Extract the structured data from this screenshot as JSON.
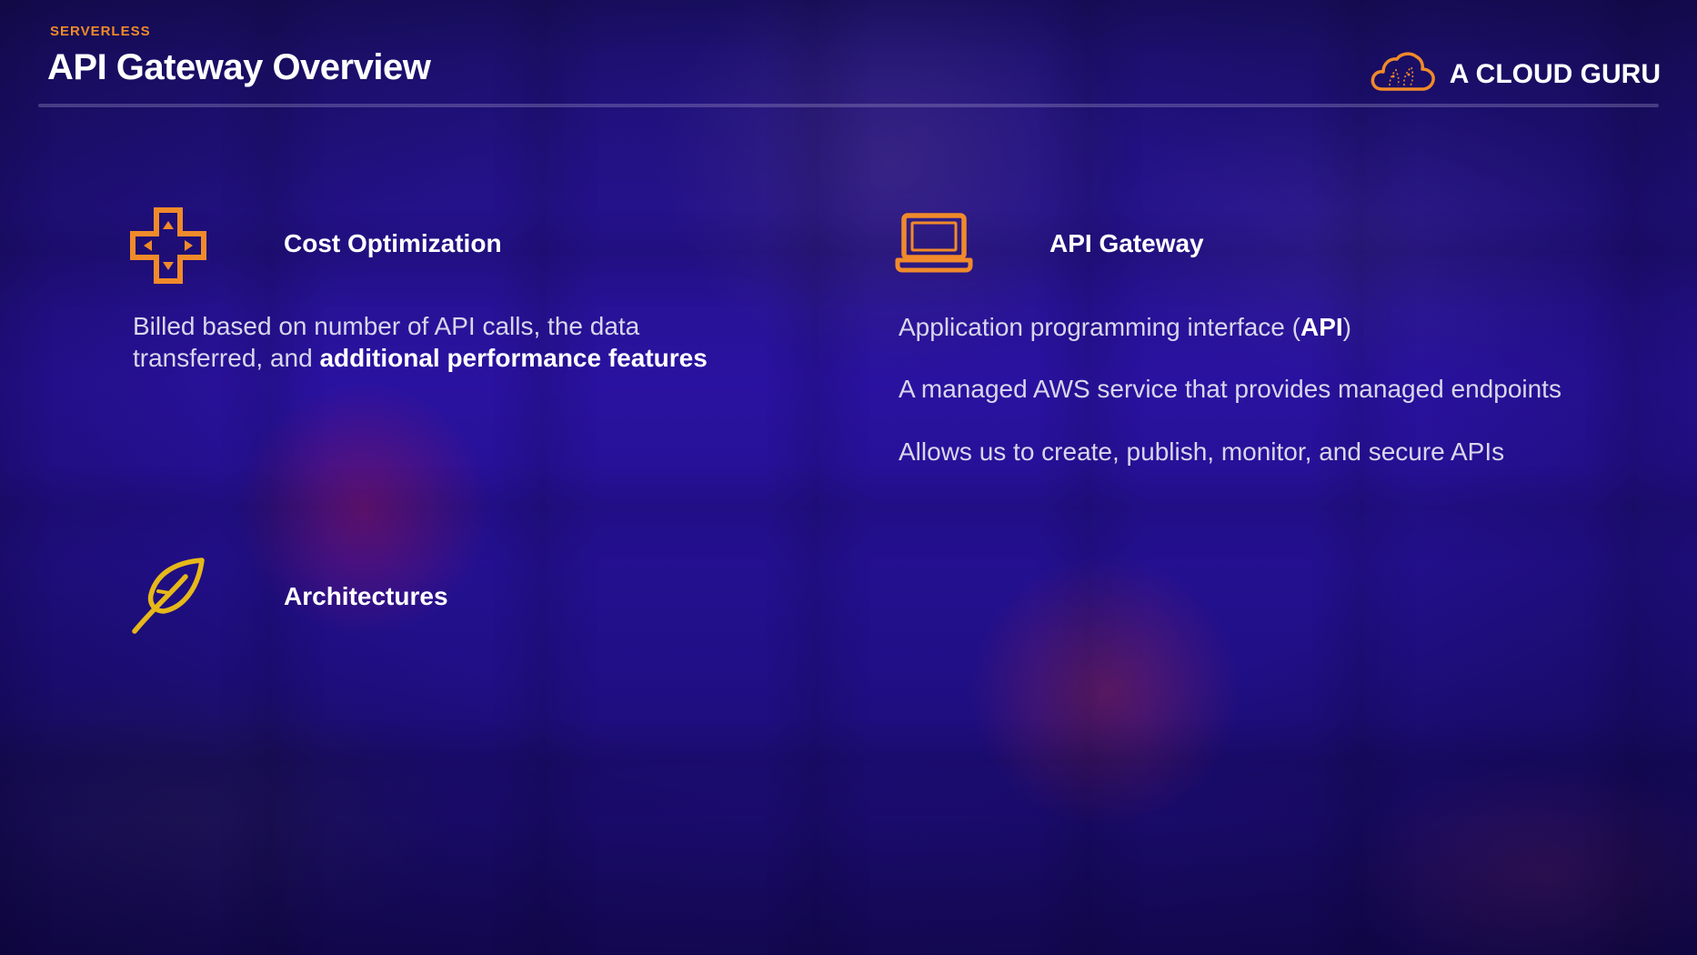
{
  "header": {
    "eyebrow": "SERVERLESS",
    "title": "API Gateway Overview",
    "brand_name": "A CLOUD GURU",
    "brand_icon": "cloud-icon"
  },
  "colors": {
    "accent_orange": "#f08a2a",
    "accent_yellow": "#e6b81a",
    "text_primary": "#ffffff",
    "text_secondary": "#d9d6ec"
  },
  "left_column": {
    "cost": {
      "icon": "dpad-icon",
      "heading": "Cost Optimization",
      "text_before": "Billed based on number of API calls, the data transferred, and ",
      "text_bold": "additional performance features"
    },
    "architectures": {
      "icon": "feather-icon",
      "heading": "Architectures"
    }
  },
  "right_column": {
    "icon": "laptop-icon",
    "heading": "API Gateway",
    "points": [
      {
        "before": "Application programming interface (",
        "bold": "API",
        "after": ")"
      },
      {
        "text": "A managed AWS service that provides managed endpoints"
      },
      {
        "text": "Allows us to create, publish, monitor, and secure APIs"
      }
    ]
  }
}
